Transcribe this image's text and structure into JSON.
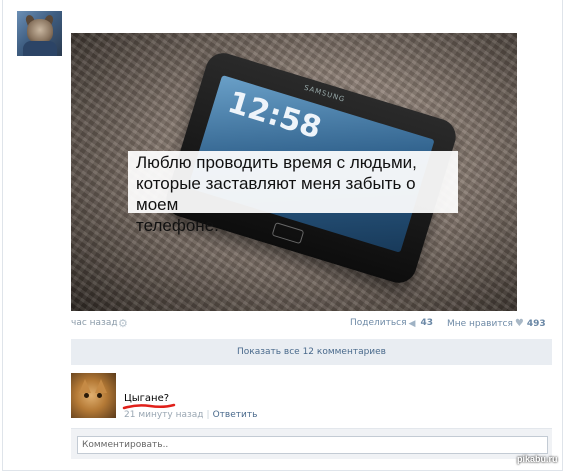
{
  "post": {
    "image_caption_lines": [
      "Люблю проводить время с людьми,",
      "которые заставляют меня забыть о моем",
      "телефоне."
    ],
    "phone_clock": "12:58",
    "phone_brand": "SAMSUNG",
    "time": "час назад",
    "share_label": "Поделиться",
    "share_count": "43",
    "like_label": "Мне нравится",
    "like_count": "493"
  },
  "show_comments_label": "Показать все 12 комментариев",
  "comment": {
    "text": "Цыгане?",
    "time": "21 минуту назад",
    "separator": "|",
    "reply_label": "Ответить",
    "underline_color": "#e0201a"
  },
  "comment_input": {
    "placeholder": "Комментировать.."
  },
  "watermark": "pikabu.ru",
  "icons": {
    "settings": "gear-icon",
    "share": "megaphone-icon",
    "like": "heart-icon"
  }
}
